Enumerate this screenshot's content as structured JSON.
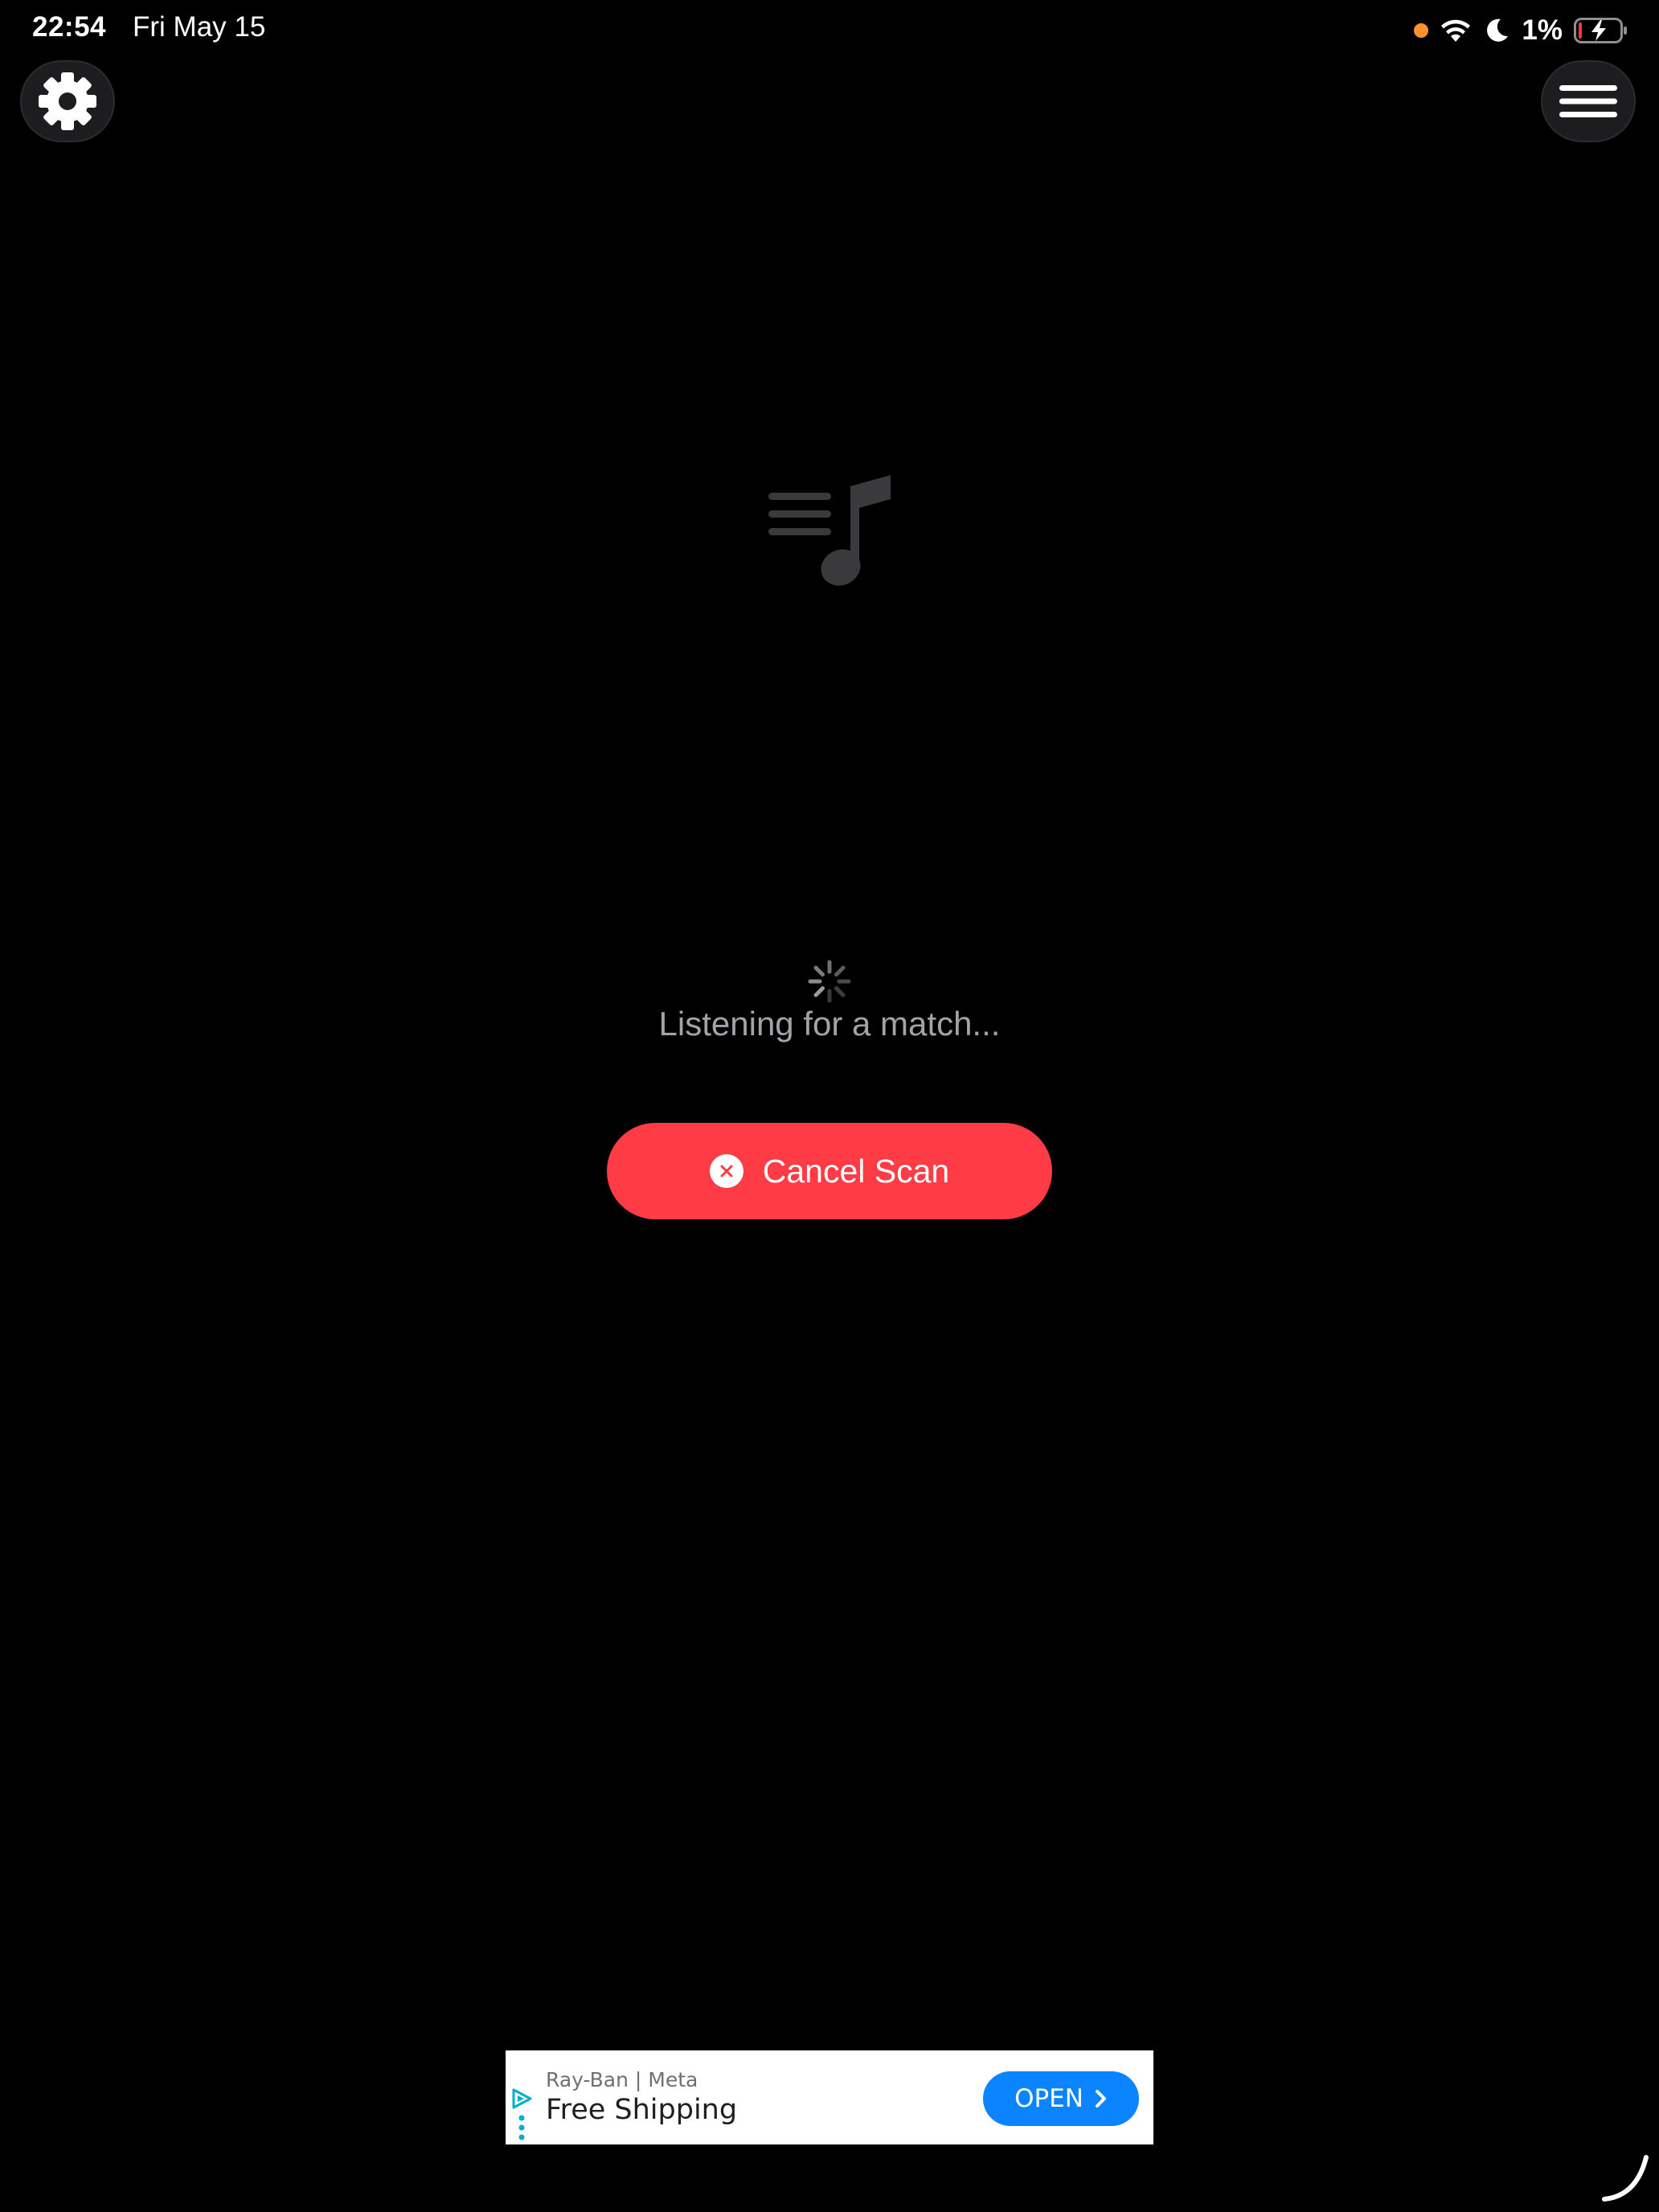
{
  "status_bar": {
    "time": "22:54",
    "date": "Fri May 15",
    "battery_percent": "1%",
    "mic_indicator_color": "#ff9230",
    "icons": [
      "mic-indicator-icon",
      "wifi-icon",
      "moon-icon",
      "battery-charging-icon"
    ]
  },
  "toolbar": {
    "settings_icon": "gear-icon",
    "menu_icon": "hamburger-menu-icon"
  },
  "main": {
    "illustration_icon": "playlist-music-note-icon",
    "status_text": "Listening for a match...",
    "cancel_button_label": "Cancel Scan",
    "cancel_button_color": "#ff3b46"
  },
  "ad": {
    "brand": "Ray-Ban | Meta",
    "headline": "Free Shipping",
    "cta_label": "OPEN",
    "cta_color": "#0a84ff"
  }
}
